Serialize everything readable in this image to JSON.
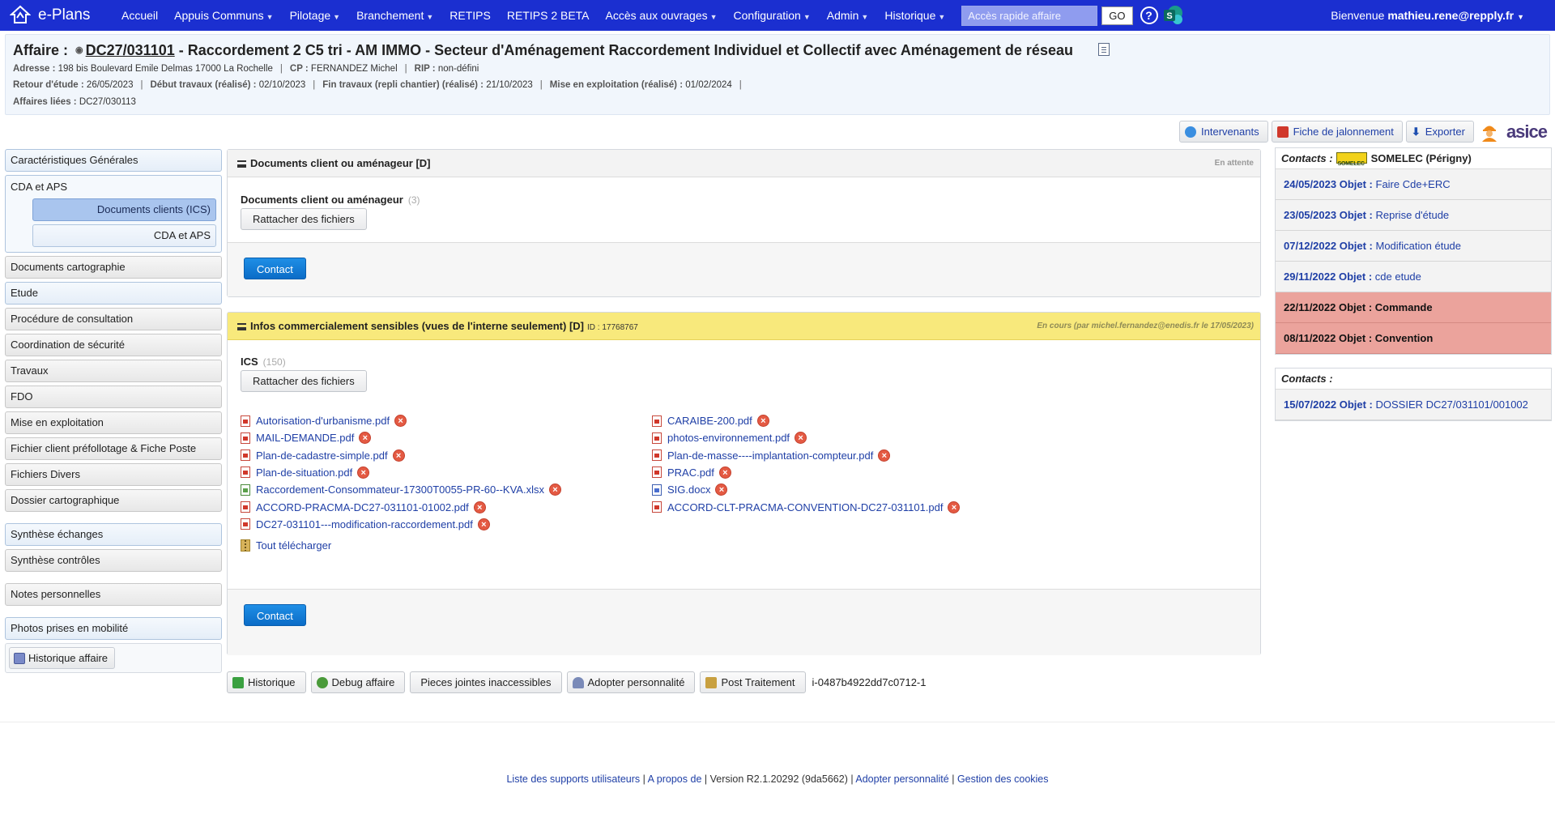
{
  "nav": {
    "app_name": "e-Plans",
    "items": [
      {
        "label": "Accueil",
        "caret": false
      },
      {
        "label": "Appuis Communs",
        "caret": true
      },
      {
        "label": "Pilotage",
        "caret": true
      },
      {
        "label": "Branchement",
        "caret": true
      },
      {
        "label": "RETIPS",
        "caret": false
      },
      {
        "label": "RETIPS 2 BETA",
        "caret": false
      },
      {
        "label": "Accès aux ouvrages",
        "caret": true
      },
      {
        "label": "Configuration",
        "caret": true
      },
      {
        "label": "Admin",
        "caret": true
      },
      {
        "label": "Historique",
        "caret": true
      }
    ],
    "quick_placeholder": "Accès rapide affaire",
    "go_label": "GO",
    "help_label": "?",
    "welcome_prefix": "Bienvenue ",
    "user": "mathieu.rene@repply.fr",
    "accent_color": "#1b2fd0"
  },
  "affaire": {
    "label": "Affaire :",
    "number": "DC27/031101",
    "title_rest": " - Raccordement 2 C5 tri - AM IMMO - Secteur d'Aménagement Raccordement Individuel et Collectif avec Aménagement de réseau",
    "line1": [
      {
        "k": "Adresse :",
        "v": "198 bis Boulevard Emile Delmas 17000 La Rochelle"
      },
      {
        "k": "CP :",
        "v": "FERNANDEZ Michel"
      },
      {
        "k": "RIP :",
        "v": "non-défini"
      }
    ],
    "line2": [
      {
        "k": "Retour d'étude :",
        "v": "26/05/2023"
      },
      {
        "k": "Début travaux (réalisé) :",
        "v": "02/10/2023"
      },
      {
        "k": "Fin travaux (repli chantier) (réalisé) :",
        "v": "21/10/2023"
      },
      {
        "k": "Mise en exploitation (réalisé) :",
        "v": "01/02/2024"
      }
    ],
    "line3": [
      {
        "k": "Affaires liées :",
        "v": "DC27/030113"
      }
    ]
  },
  "toolbar": {
    "intervenants": "Intervenants",
    "fiche": "Fiche de jalonnement",
    "exporter": "Exporter",
    "brand": "asice"
  },
  "sidebar": {
    "caracteristiques": "Caractéristiques Générales",
    "group_label": "CDA et APS",
    "sub_active": "Documents clients (ICS)",
    "sub_other": "CDA et APS",
    "items_a": [
      "Documents cartographie",
      "Etude",
      "Procédure de consultation",
      "Coordination de sécurité",
      "Travaux",
      "FDO",
      "Mise en exploitation",
      "Fichier client préfollotage & Fiche Poste",
      "Fichiers Divers",
      "Dossier cartographique"
    ],
    "items_b": [
      "Synthèse échanges",
      "Synthèse contrôles"
    ],
    "items_c": [
      "Notes personnelles"
    ],
    "items_d": [
      "Photos prises en mobilité"
    ],
    "historique": "Historique affaire"
  },
  "panel1": {
    "title": "Documents client ou aménageur",
    "tag": "[D]",
    "status": "En attente",
    "section": "Documents client ou aménageur",
    "count": "(3)",
    "attach": "Rattacher des fichiers",
    "contact": "Contact"
  },
  "panel2": {
    "title": "Infos commercialement sensibles (vues de l'interne seulement)",
    "tag": "[D]",
    "id_text": "ID : 17768767",
    "status": "En cours (par michel.fernandez@enedis.fr le 17/05/2023)",
    "section": "ICS",
    "count": "(150)",
    "attach": "Rattacher des fichiers",
    "files_left": [
      {
        "name": "Autorisation-d'urbanisme.pdf",
        "type": "pdf"
      },
      {
        "name": "MAIL-DEMANDE.pdf",
        "type": "pdf"
      },
      {
        "name": "Plan-de-cadastre-simple.pdf",
        "type": "pdf"
      },
      {
        "name": "Plan-de-situation.pdf",
        "type": "pdf"
      },
      {
        "name": "Raccordement-Consommateur-17300T0055-PR-60--KVA.xlsx",
        "type": "xls"
      },
      {
        "name": "ACCORD-PRACMA-DC27-031101-01002.pdf",
        "type": "pdf"
      },
      {
        "name": "DC27-031101---modification-raccordement.pdf",
        "type": "pdf"
      }
    ],
    "files_right": [
      {
        "name": "CARAIBE-200.pdf",
        "type": "pdf"
      },
      {
        "name": "photos-environnement.pdf",
        "type": "pdf"
      },
      {
        "name": "Plan-de-masse----implantation-compteur.pdf",
        "type": "pdf"
      },
      {
        "name": "PRAC.pdf",
        "type": "pdf"
      },
      {
        "name": "SIG.docx",
        "type": "doc"
      },
      {
        "name": "ACCORD-CLT-PRACMA-CONVENTION-DC27-031101.pdf",
        "type": "pdf"
      }
    ],
    "download_all": "Tout télécharger",
    "contact": "Contact"
  },
  "actions": {
    "historique": "Historique",
    "debug": "Debug affaire",
    "pieces": "Pieces jointes inaccessibles",
    "adopter": "Adopter personnalité",
    "post": "Post Traitement",
    "uid": "i-0487b4922dd7c0712-1"
  },
  "contacts1": {
    "label": "Contacts :",
    "company": "SOMELEC (Périgny)",
    "rows": [
      {
        "date": "24/05/2023",
        "obj": "Objet :",
        "text": "Faire Cde+ERC",
        "red": false
      },
      {
        "date": "23/05/2023",
        "obj": "Objet :",
        "text": "Reprise d'étude",
        "red": false
      },
      {
        "date": "07/12/2022",
        "obj": "Objet :",
        "text": "Modification étude",
        "red": false
      },
      {
        "date": "29/11/2022",
        "obj": "Objet :",
        "text": "cde etude",
        "red": false
      },
      {
        "date": "22/11/2022",
        "obj": "Objet :",
        "text": "Commande",
        "red": true
      },
      {
        "date": "08/11/2022",
        "obj": "Objet :",
        "text": "Convention",
        "red": true
      }
    ]
  },
  "contacts2": {
    "label": "Contacts :",
    "rows": [
      {
        "date": "15/07/2022",
        "obj": "Objet :",
        "text": "DOSSIER DC27/031101/001002",
        "red": false
      }
    ]
  },
  "footer": {
    "support": "Liste des supports utilisateurs",
    "apropos": "A propos de",
    "version": "Version R2.1.20292 (9da5662)",
    "adopter": "Adopter personnalité",
    "cookies": "Gestion des cookies"
  }
}
